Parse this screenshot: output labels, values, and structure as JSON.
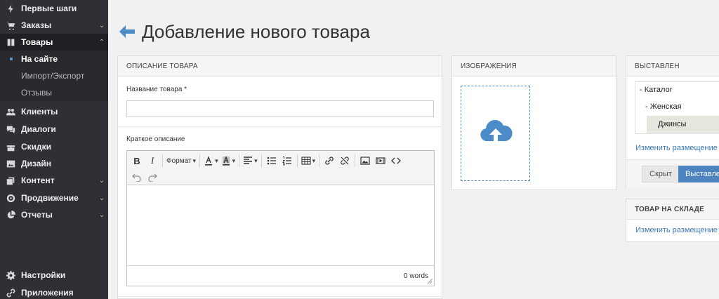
{
  "sidebar": {
    "items": [
      {
        "label": "Первые шаги",
        "icon": "lightning-icon"
      },
      {
        "label": "Заказы",
        "icon": "cart-icon",
        "chevron": "⌄"
      },
      {
        "label": "Товары",
        "icon": "book-icon",
        "chevron": "⌃"
      },
      {
        "label": "Клиенты",
        "icon": "users-icon"
      },
      {
        "label": "Диалоги",
        "icon": "chat-icon"
      },
      {
        "label": "Скидки",
        "icon": "gift-icon"
      },
      {
        "label": "Дизайн",
        "icon": "image-icon"
      },
      {
        "label": "Контент",
        "icon": "layers-icon",
        "chevron": "⌄"
      },
      {
        "label": "Продвижение",
        "icon": "target-icon",
        "chevron": "⌄"
      },
      {
        "label": "Отчеты",
        "icon": "pie-chart-icon",
        "chevron": "⌄"
      },
      {
        "label": "Настройки",
        "icon": "gear-icon"
      },
      {
        "label": "Приложения",
        "icon": "link-icon"
      }
    ],
    "subitems": [
      {
        "label": "На сайте"
      },
      {
        "label": "Импорт/Экспорт"
      },
      {
        "label": "Отзывы"
      }
    ]
  },
  "page": {
    "title": "Добавление нового товара"
  },
  "description": {
    "header": "ОПИСАНИЕ ТОВАРА",
    "name_label": "Название товара *",
    "name_value": "",
    "short_label": "Краткое описание",
    "toolbar": {
      "format_label": "Формат"
    },
    "word_count": "0 words"
  },
  "images": {
    "header": "ИЗОБРАЖЕНИЯ"
  },
  "placement": {
    "header": "ВЫСТАВЛЕН",
    "tree": [
      {
        "label": "- Каталог"
      },
      {
        "label": "- Женская"
      },
      {
        "label": "Джинсы"
      }
    ],
    "change_link": "Изменить размещение",
    "toggle_off": "Скрыт",
    "toggle_on": "Выставлен"
  },
  "stock": {
    "header": "ТОВАР НА СКЛАДЕ",
    "change_link": "Изменить размещение"
  },
  "colors": {
    "sidebar_bg": "#2f3035",
    "accent": "#4a8bc8",
    "link": "#3a78b8"
  }
}
